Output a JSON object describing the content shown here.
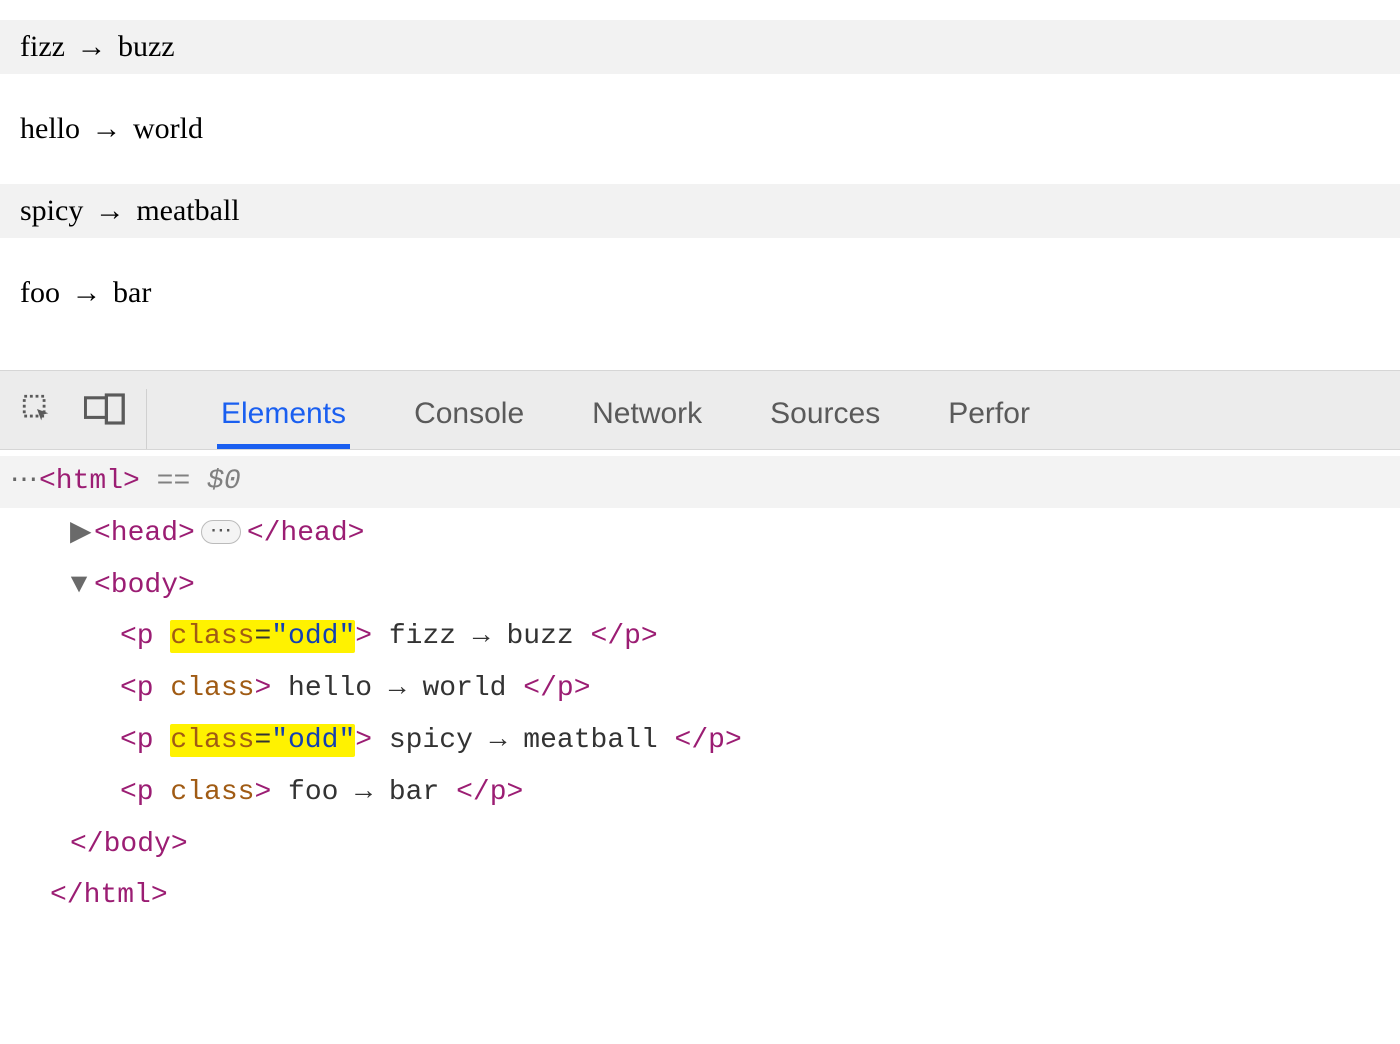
{
  "page": {
    "items": [
      {
        "left": "fizz",
        "arrow": "→",
        "right": "buzz",
        "odd": true
      },
      {
        "left": "hello",
        "arrow": "→",
        "right": "world",
        "odd": false
      },
      {
        "left": "spicy",
        "arrow": "→",
        "right": "meatball",
        "odd": true
      },
      {
        "left": "foo",
        "arrow": "→",
        "right": "bar",
        "odd": false
      }
    ]
  },
  "devtools": {
    "tabs": {
      "elements": "Elements",
      "console": "Console",
      "network": "Network",
      "sources": "Sources",
      "performance": "Perfor"
    },
    "selected_eq": "== $0",
    "dom": {
      "html_open": "<html>",
      "head_open": "<head>",
      "head_ellipsis": "⋯",
      "head_close": "</head>",
      "body_open": "<body>",
      "p_open": "<p",
      "class_kw": "class",
      "eq": "=",
      "odd_val": "\"odd\"",
      "close_gt": ">",
      "p_close": "</p>",
      "body_close": "</body>",
      "html_close": "</html>",
      "texts": {
        "r1": " fizz → buzz ",
        "r2": " hello → world ",
        "r3": " spicy → meatball ",
        "r4": " foo → bar "
      }
    },
    "triangles": {
      "right": "▶",
      "down": "▼"
    },
    "leading_ellipsis": "⋯"
  }
}
